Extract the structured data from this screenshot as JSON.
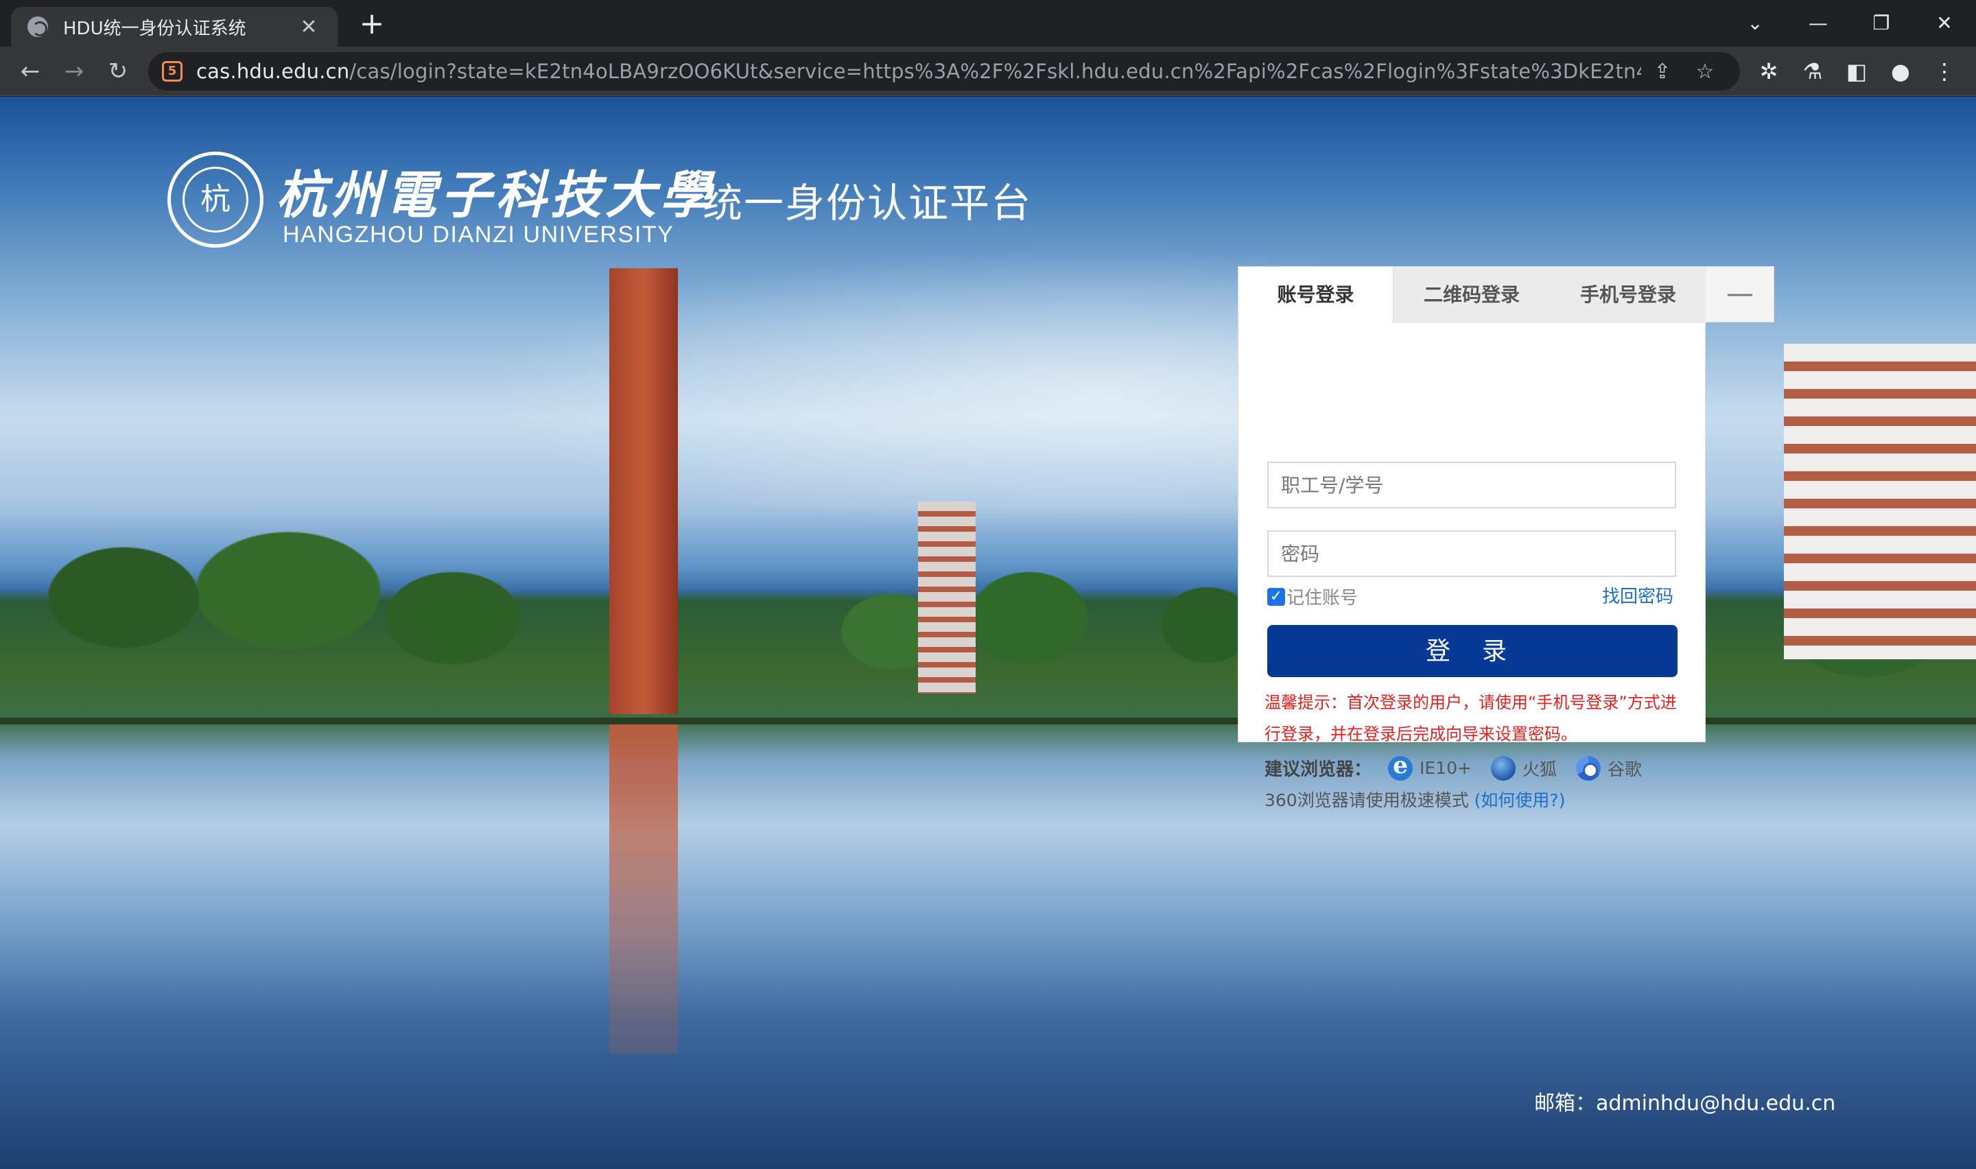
{
  "browser": {
    "tab_title": "HDU统一身份认证系统",
    "tab_close": "✕",
    "new_tab": "+",
    "window_controls": {
      "dropdown": "⌄",
      "minimize": "—",
      "restore": "❐",
      "close": "✕"
    },
    "url_host": "cas.hdu.edu.cn",
    "url_rest": "/cas/login?state=kE2tn4oLBA9rzOO6KUt&service=https%3A%2F%2Fskl.hdu.edu.cn%2Fapi%2Fcas%2Flogin%3Fstate%3DkE2tn4oLBA9rzOO6...",
    "nav": {
      "back": "←",
      "forward": "→",
      "reload": "↻"
    },
    "icons": [
      "share-icon",
      "star-icon",
      "puzzle-icon",
      "flask-icon",
      "sidepanel-icon",
      "profile-icon",
      "menu-icon"
    ]
  },
  "page": {
    "logo_seal_text": "杭",
    "logo_cn": "杭州電子科技大學",
    "logo_en": "HANGZHOU DIANZI UNIVERSITY",
    "platform_title": "统一身份认证平台",
    "login": {
      "tabs": [
        "账号登录",
        "二维码登录",
        "手机号登录"
      ],
      "collapse": "—",
      "username_placeholder": "职工号/学号",
      "password_placeholder": "密码",
      "remember_label": "记住账号",
      "forgot_link": "找回密码",
      "submit_label": "登 录",
      "notice": "温馨提示：首次登录的用户，请使用“手机号登录”方式进行登录，并在登录后完成向导来设置密码。",
      "browsers_label": "建议浏览器：",
      "browsers": [
        {
          "name": "IE10+",
          "icon": "ie-icon"
        },
        {
          "name": "火狐",
          "icon": "firefox-icon"
        },
        {
          "name": "谷歌",
          "icon": "chrome-icon"
        }
      ],
      "hint_360": "360浏览器请使用极速模式 ",
      "hint_link": "(如何使用?)"
    },
    "email": "邮箱：adminhdu@hdu.edu.cn"
  }
}
